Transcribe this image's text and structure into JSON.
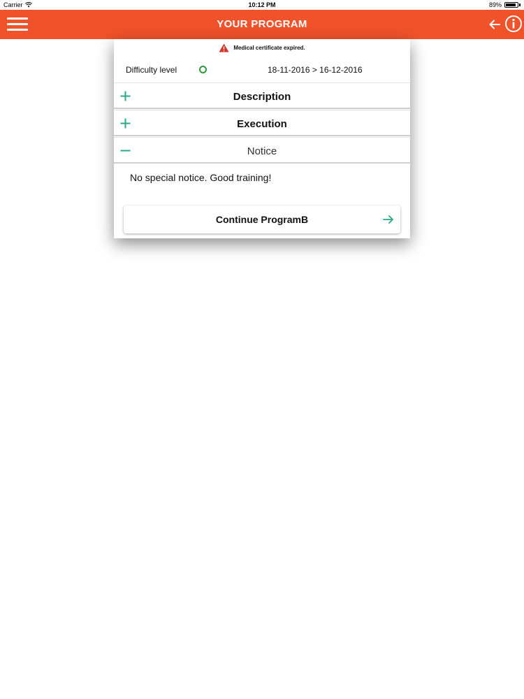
{
  "status_bar": {
    "carrier": "Carrier",
    "time": "10:12 PM",
    "battery": "89%",
    "battery_level": 0.89
  },
  "navbar": {
    "title": "YOUR PROGRAM",
    "color": "#f0522a",
    "icons": [
      "menu-icon",
      "back-arrow-icon",
      "info-icon"
    ]
  },
  "card": {
    "warning": {
      "text": "Medical certificate expired.",
      "icon": "warning-icon",
      "color": "#d93025"
    },
    "difficulty_label": "Difficulty level",
    "difficulty_color": "#2a9a3a",
    "date_range": "18-11-2016 > 16-12-2016",
    "sections": [
      {
        "title": "Description",
        "expanded": false,
        "icon": "plus-icon"
      },
      {
        "title": "Execution",
        "expanded": false,
        "icon": "plus-icon"
      },
      {
        "title": "Notice",
        "expanded": true,
        "icon": "minus-icon"
      }
    ],
    "notice_text": "No special notice. Good training!",
    "continue_button": {
      "label": "Continue ProgramB",
      "icon": "arrow-right-icon"
    },
    "accent_color": "#2aa889"
  }
}
